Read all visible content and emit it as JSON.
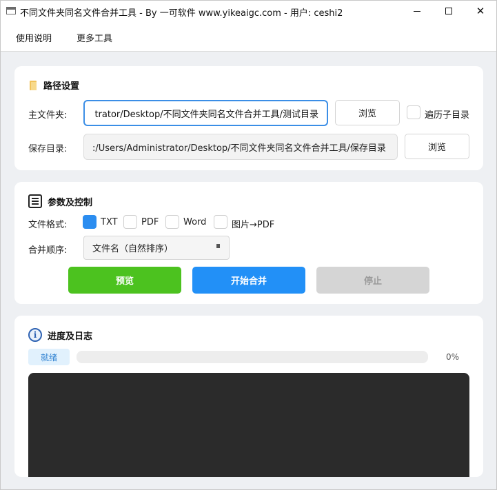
{
  "window": {
    "title": "不同文件夹同名文件合并工具 - By 一可软件 www.yikeaigc.com - 用户: ceshi2",
    "minimize_glyph": "",
    "close_glyph": "✕"
  },
  "menu": {
    "help": "使用说明",
    "tools": "更多工具"
  },
  "path_section": {
    "title": "路径设置",
    "main_label": "主文件夹:",
    "main_value": "C:/Users/Administrator/Desktop/不同文件夹同名文件合并工具/测试目录",
    "main_visible": "trator/Desktop/不同文件夹同名文件合并工具/测试目录",
    "browse_label": "浏览",
    "recurse_label": "遍历子目录",
    "recurse_checked": false,
    "save_label": "保存目录:",
    "save_value": "C:/Users/Administrator/Desktop/不同文件夹同名文件合并工具/保存目录",
    "save_visible": ":/Users/Administrator/Desktop/不同文件夹同名文件合并工具/保存目录",
    "save_browse_label": "浏览"
  },
  "params_section": {
    "title": "参数及控制",
    "format_label": "文件格式:",
    "formats": [
      {
        "label": "TXT",
        "checked": true
      },
      {
        "label": "PDF",
        "checked": false
      },
      {
        "label": "Word",
        "checked": false
      },
      {
        "label": "图片→PDF",
        "checked": false
      }
    ],
    "order_label": "合并顺序:",
    "order_value": "文件名（自然排序）",
    "preview_label": "预览",
    "start_label": "开始合并",
    "stop_label": "停止"
  },
  "log_section": {
    "title": "进度及日志",
    "status": "就绪",
    "progress": 0,
    "progress_text": "0%"
  },
  "colors": {
    "accent": "#2290f7",
    "preview_green": "#4cc21f",
    "disabled_gray": "#d5d5d5",
    "log_bg": "#2b2b2b"
  }
}
